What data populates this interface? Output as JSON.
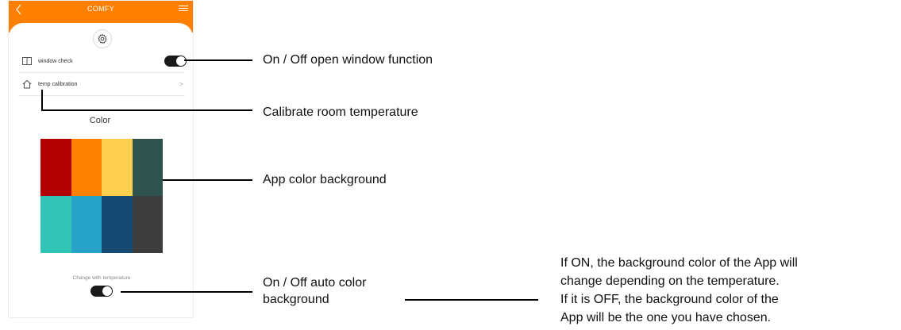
{
  "app": {
    "title": "COMFY",
    "back_icon": "chevron-left-icon",
    "menu_icon": "hamburger-menu-icon",
    "theme_color": "#ff8000"
  },
  "settings": {
    "gear_icon": "gear-icon",
    "window_check": {
      "label": "window check",
      "icon": "open-window-icon",
      "enabled": true
    },
    "temp_calibration": {
      "label": "temp calibration",
      "icon": "house-icon",
      "chevron": ">"
    }
  },
  "color_section": {
    "title": "Color",
    "swatches": [
      "#b20000",
      "#ff8100",
      "#ffcf50",
      "#2e524e",
      "#32c3b7",
      "#27a2c8",
      "#164a75",
      "#3d3d3d"
    ],
    "change_with_temperature": {
      "label": "Change with temperature",
      "enabled": true
    }
  },
  "annotations": {
    "window_function": "On / Off open window function",
    "calibrate": "Calibrate room temperature",
    "app_color": "App color background",
    "auto_color_line1": "On / Off auto color",
    "auto_color_line2": "background",
    "explanation": [
      "If ON, the background color of the App will",
      "change depending on the temperature.",
      "If it is OFF, the background color of the",
      "App will be the one you have chosen."
    ]
  }
}
